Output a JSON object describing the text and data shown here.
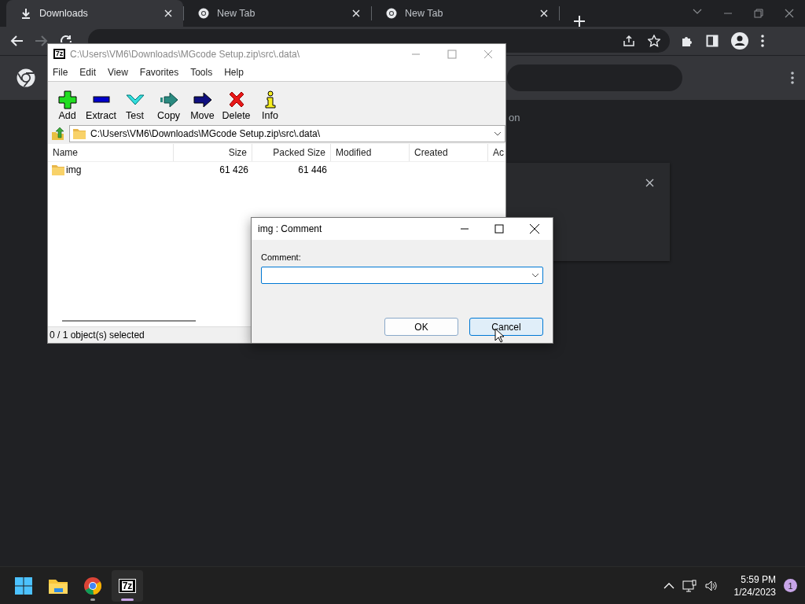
{
  "browser": {
    "tabs": [
      {
        "label": "Downloads",
        "selected": true,
        "kind": "download"
      },
      {
        "label": "New Tab",
        "selected": false,
        "kind": "chrome"
      },
      {
        "label": "New Tab",
        "selected": false,
        "kind": "chrome"
      }
    ],
    "page_text": "on"
  },
  "archive_window": {
    "logo": "7z",
    "title": "C:\\Users\\VM6\\Downloads\\MGcode Setup.zip\\src\\.data\\",
    "menu": [
      "File",
      "Edit",
      "View",
      "Favorites",
      "Tools",
      "Help"
    ],
    "toolbar": [
      {
        "label": "Add",
        "kind": "add"
      },
      {
        "label": "Extract",
        "kind": "extract"
      },
      {
        "label": "Test",
        "kind": "test"
      },
      {
        "label": "Copy",
        "kind": "copy"
      },
      {
        "label": "Move",
        "kind": "move"
      },
      {
        "label": "Delete",
        "kind": "delete"
      },
      {
        "label": "Info",
        "kind": "info"
      }
    ],
    "path": "C:\\Users\\VM6\\Downloads\\MGcode Setup.zip\\src\\.data\\",
    "columns": [
      "Name",
      "Size",
      "Packed Size",
      "Modified",
      "Created",
      "Ac"
    ],
    "rows": [
      {
        "name": "img",
        "size": "61 426",
        "packed_size": "61 446"
      }
    ],
    "status": "0 / 1 object(s) selected"
  },
  "comment_dialog": {
    "title": "img : Comment",
    "label": "Comment:",
    "buttons": [
      {
        "label": "OK",
        "hovered": false
      },
      {
        "label": "Cancel",
        "hovered": true
      }
    ]
  },
  "taskbar": {
    "apps": [
      {
        "kind": "start",
        "active": false
      },
      {
        "kind": "explorer",
        "active": false
      },
      {
        "kind": "chrome",
        "active": false
      },
      {
        "kind": "sevenzip",
        "label": "7z",
        "active": true
      }
    ],
    "time": "5:59 PM",
    "date": "1/24/2023",
    "notification_count": "1"
  }
}
